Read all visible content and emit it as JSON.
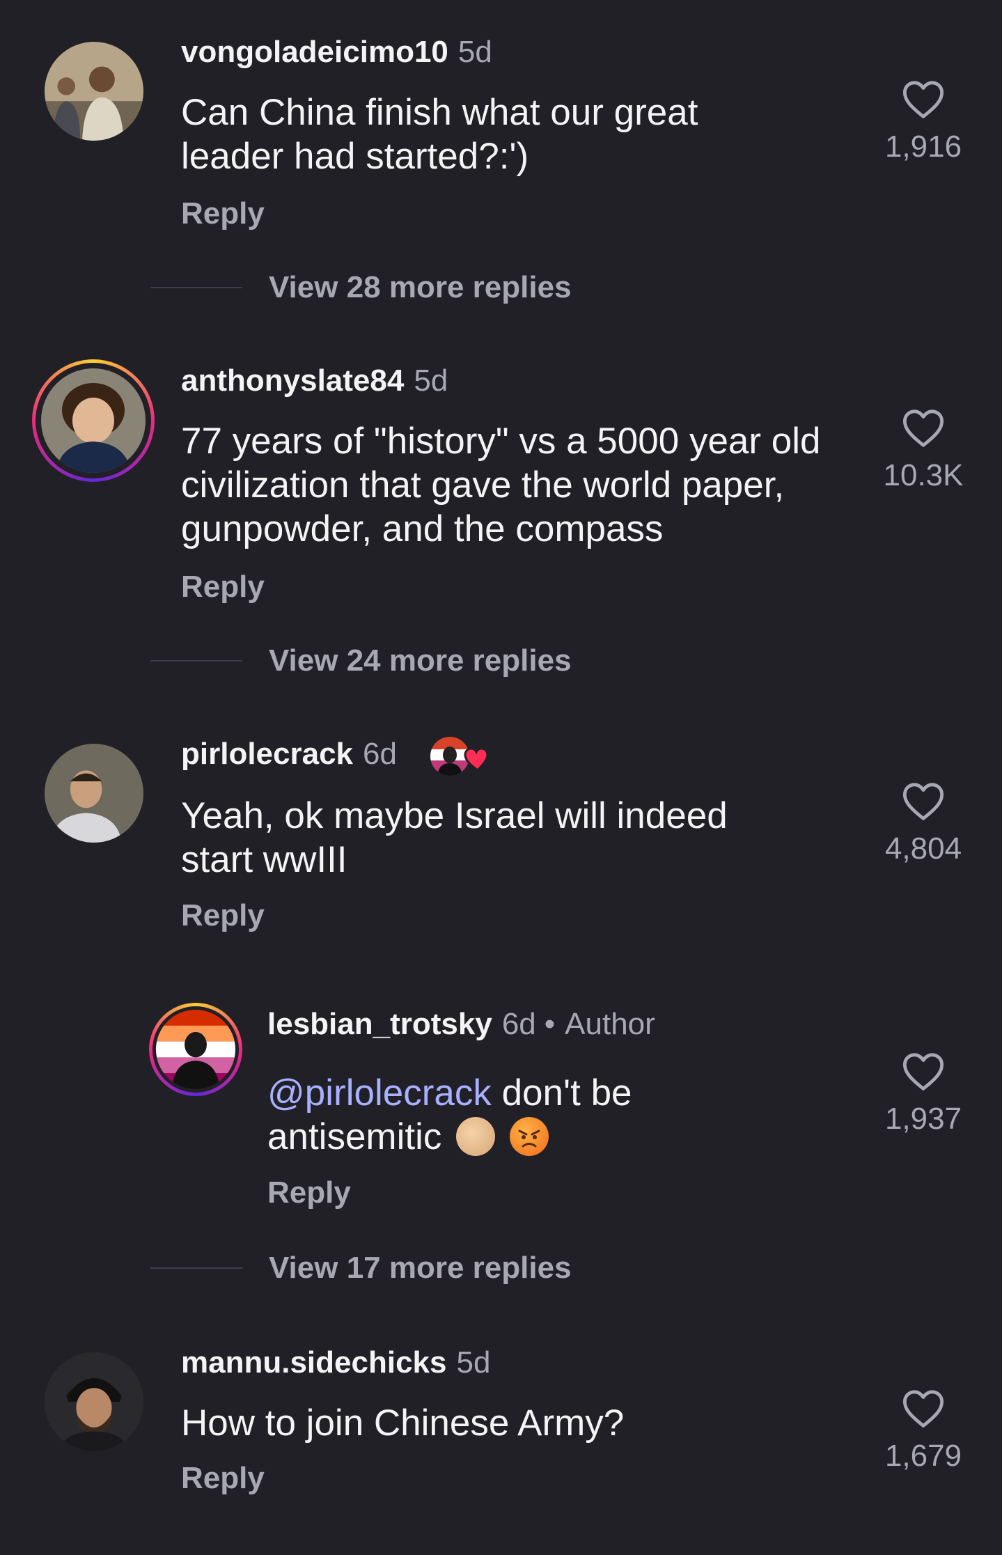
{
  "comments": [
    {
      "username": "vongoladeicimo10",
      "time": "5d",
      "text": "Can China finish what our great leader had started?:')",
      "reply_label": "Reply",
      "likes": "1,916",
      "view_more": "View 28 more replies"
    },
    {
      "username": "anthonyslate84",
      "time": "5d",
      "text": "77 years of \"history\" vs a 5000 year old civilization that gave the world paper, gunpowder, and the compass",
      "reply_label": "Reply",
      "likes": "10.3K",
      "view_more": "View 24 more replies"
    },
    {
      "username": "pirlolecrack",
      "time": "6d",
      "text": "Yeah, ok maybe Israel will indeed start wwIII",
      "reply_label": "Reply",
      "likes": "4,804"
    },
    {
      "username": "lesbian_trotsky",
      "time": "6d",
      "author_label": "Author",
      "mention": "@pirlolecrack",
      "text": "don't be antisemitic",
      "reply_label": "Reply",
      "likes": "1,937",
      "view_more": "View 17 more replies"
    },
    {
      "username": "mannu.sidechicks",
      "time": "5d",
      "text": "How to join Chinese Army?",
      "reply_label": "Reply",
      "likes": "1,679"
    }
  ],
  "icons": {
    "like": "heart-outline-icon",
    "badge": "creator-heart-icon",
    "emoji_1": "pointing-hand-emoji",
    "emoji_2": "angry-face-emoji"
  },
  "colors": {
    "background": "#202026",
    "text": "#f4f4f6",
    "secondary": "#a8a8b0",
    "mention": "#a8b0ff",
    "heart_badge": "#ff2d55"
  }
}
